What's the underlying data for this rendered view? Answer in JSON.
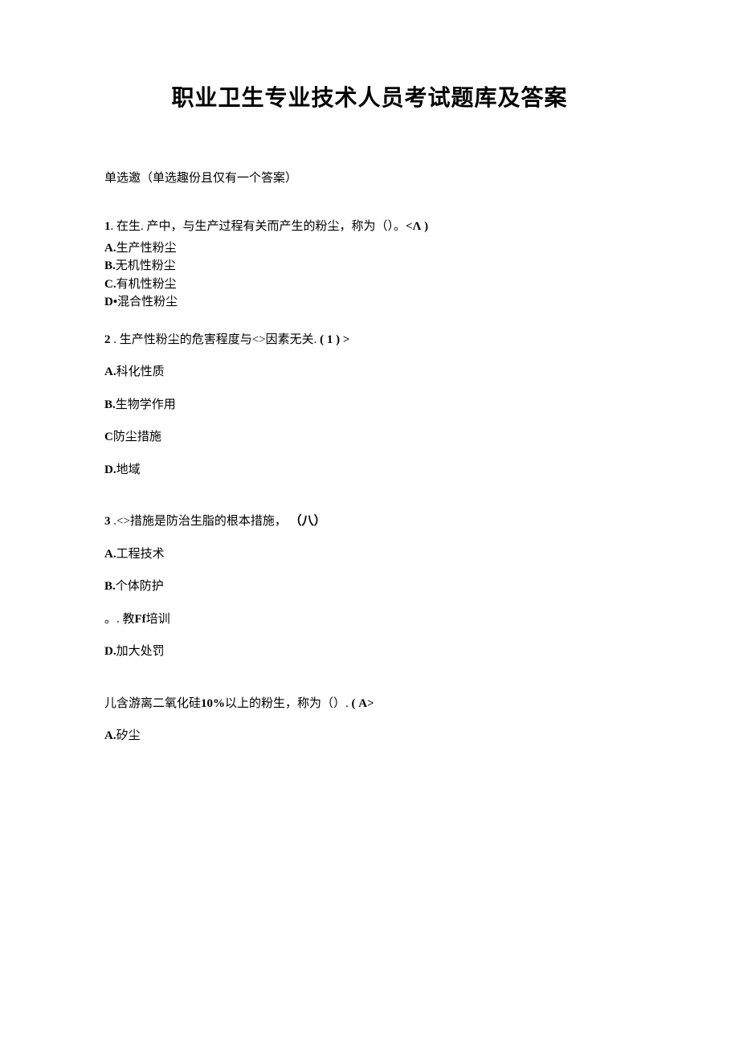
{
  "title": "职业卫生专业技术人员考试题库及答案",
  "hint": "单选邀（单选趣份且仅有一个答案）",
  "q1": {
    "num": "1",
    "stem_a": ". 在生. 产中，与生产过程有关而产生的粉尘，称为（）。",
    "tag": "<Λ )",
    "a_label": "A.",
    "a_text": "生产性粉尘",
    "b_label": "B.",
    "b_text": "无机性粉尘",
    "c_label": "C.",
    "c_text": "有机性粉尘",
    "d_label": "D•",
    "d_text": "混合性粉尘"
  },
  "q2": {
    "num": "2",
    "stem_a": "   . 生产性粉尘的危害程度与<>因素无关.",
    "tag": "( 1 ) >",
    "a_label": "A.",
    "a_text": "科化性质",
    "b_label": "B.",
    "b_text": "生物学作用",
    "c_label": "C",
    "c_text": "防尘措施",
    "d_label": "D.",
    "d_text": "地域"
  },
  "q3": {
    "num": "3",
    "stem_a": "   .<>措施是防治生脂的根本措施，",
    "tag": "（八）",
    "a_label": "A.",
    "a_text": "工程技术",
    "b_label": "B.",
    "b_text": "个体防护",
    "c_label": "。. 教",
    "c_mid": "Ff",
    "c_text": "培训",
    "d_label": "D.",
    "d_text": "加大处罚"
  },
  "q4": {
    "stem_a": "儿含游离二氧化硅",
    "stem_mid": "10%",
    "stem_b": "以上的粉生，称为（）.",
    "tag": "( A>",
    "a_label": "A.",
    "a_text": "矽尘"
  }
}
